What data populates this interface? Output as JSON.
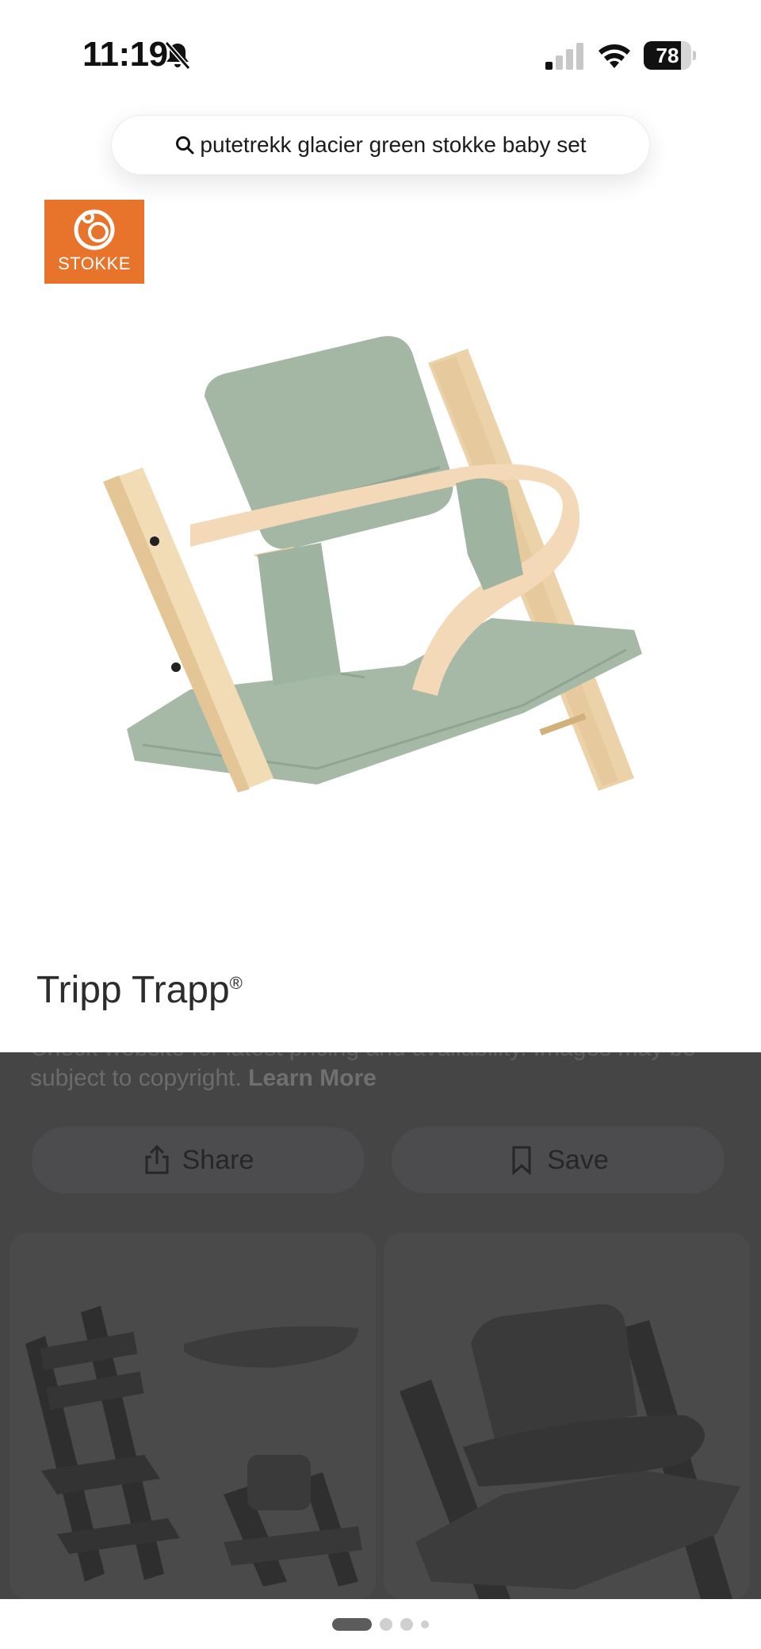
{
  "status_bar": {
    "time": "11:19",
    "battery_level": "78",
    "battery_fraction": 0.78,
    "icons": [
      "bell-off-icon",
      "signal-icon",
      "wifi-icon",
      "battery-icon"
    ]
  },
  "search": {
    "query": "putetrekk glacier green stokke baby set"
  },
  "product": {
    "brand_logo_text": "STOKKE",
    "title": "Tripp Trapp",
    "title_mark": "®",
    "image_description_icon": "chair-cushion-image"
  },
  "sheet": {
    "disclaimer_cut_line": "Check website for latest pricing and availability. Images may be",
    "disclaimer_line": "subject to copyright.",
    "learn_more": "Learn More",
    "share_label": "Share",
    "save_label": "Save",
    "thumbnails": [
      {
        "icon": "chair-set-thumbnail"
      },
      {
        "icon": "cushion-thumbnail"
      }
    ]
  },
  "pager": {
    "pages": 4,
    "active_index": 0
  },
  "colors": {
    "brand_orange": "#e8732a",
    "cushion_green": "#a5b7a6",
    "wood": "#f0d9b5",
    "overlay": "#454545"
  }
}
